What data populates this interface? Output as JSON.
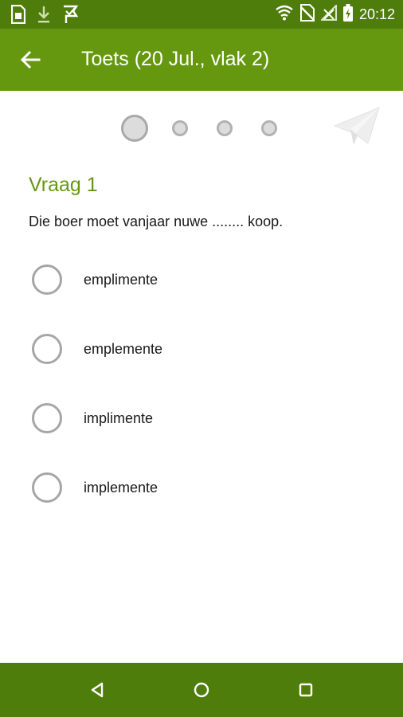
{
  "status_bar": {
    "time": "20:12",
    "left_icons": [
      "sim-card-icon",
      "download-icon",
      "check-flag-icon"
    ],
    "right_icons": [
      "wifi-icon",
      "no-sim-icon",
      "signal-icon",
      "battery-charging-icon"
    ]
  },
  "app_bar": {
    "title": "Toets (20 Jul., vlak 2)",
    "back_icon": "arrow-left-icon"
  },
  "stepper": {
    "total": 4,
    "current": 1,
    "send_icon": "paper-plane-icon"
  },
  "question": {
    "title": "Vraag 1",
    "text": "Die boer moet vanjaar nuwe ........ koop.",
    "options": [
      {
        "label": "emplimente",
        "selected": false
      },
      {
        "label": "emplemente",
        "selected": false
      },
      {
        "label": "implimente",
        "selected": false
      },
      {
        "label": "implemente",
        "selected": false
      }
    ]
  },
  "nav_bar": {
    "icons": [
      "back-triangle-icon",
      "home-circle-icon",
      "recents-square-icon"
    ]
  },
  "colors": {
    "status_bar": "#4f7d0b",
    "app_bar": "#65980f",
    "accent": "#65980f",
    "nav_bar": "#4f7d0b"
  }
}
